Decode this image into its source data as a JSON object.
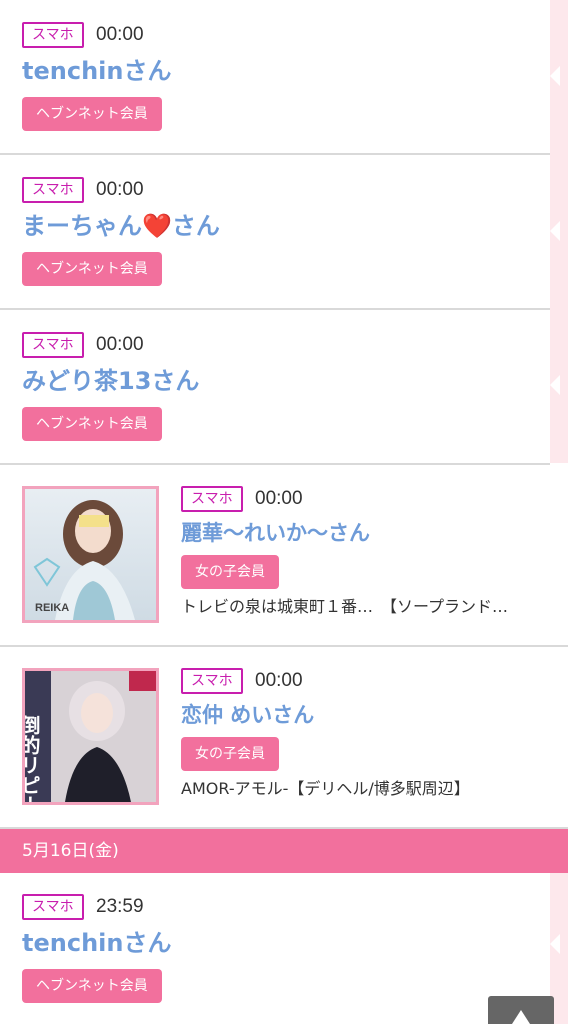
{
  "colors": {
    "accent_pink": "#f2709d",
    "device_magenta": "#c81eae",
    "name_blue": "#6e9bd8"
  },
  "entries": [
    {
      "device": "スマホ",
      "time": "00:00",
      "name": "tenchinさん",
      "member": "ヘブンネット会員"
    },
    {
      "device": "スマホ",
      "time": "00:00",
      "name": "まーちゃん❤️さん",
      "member": "ヘブンネット会員"
    },
    {
      "device": "スマホ",
      "time": "00:00",
      "name": "みどり茶13さん",
      "member": "ヘブンネット会員"
    },
    {
      "device": "スマホ",
      "time": "00:00",
      "name": "麗華〜れいか〜さん",
      "member": "女の子会員",
      "shop": "トレビの泉は城東町１番…　【ソープランド…",
      "thumb_text": "REIKA"
    },
    {
      "device": "スマホ",
      "time": "00:00",
      "name": "恋仲 めいさん",
      "member": "女の子会員",
      "shop": "AMOR-アモル-【デリヘル/博多駅周辺】",
      "thumb_text": "倒的リピート"
    }
  ],
  "date_header": "5月16日(金)",
  "entries_after": [
    {
      "device": "スマホ",
      "time": "23:59",
      "name": "tenchinさん",
      "member": "ヘブンネット会員"
    }
  ],
  "scroll_top_icon": "triangle-up-icon"
}
